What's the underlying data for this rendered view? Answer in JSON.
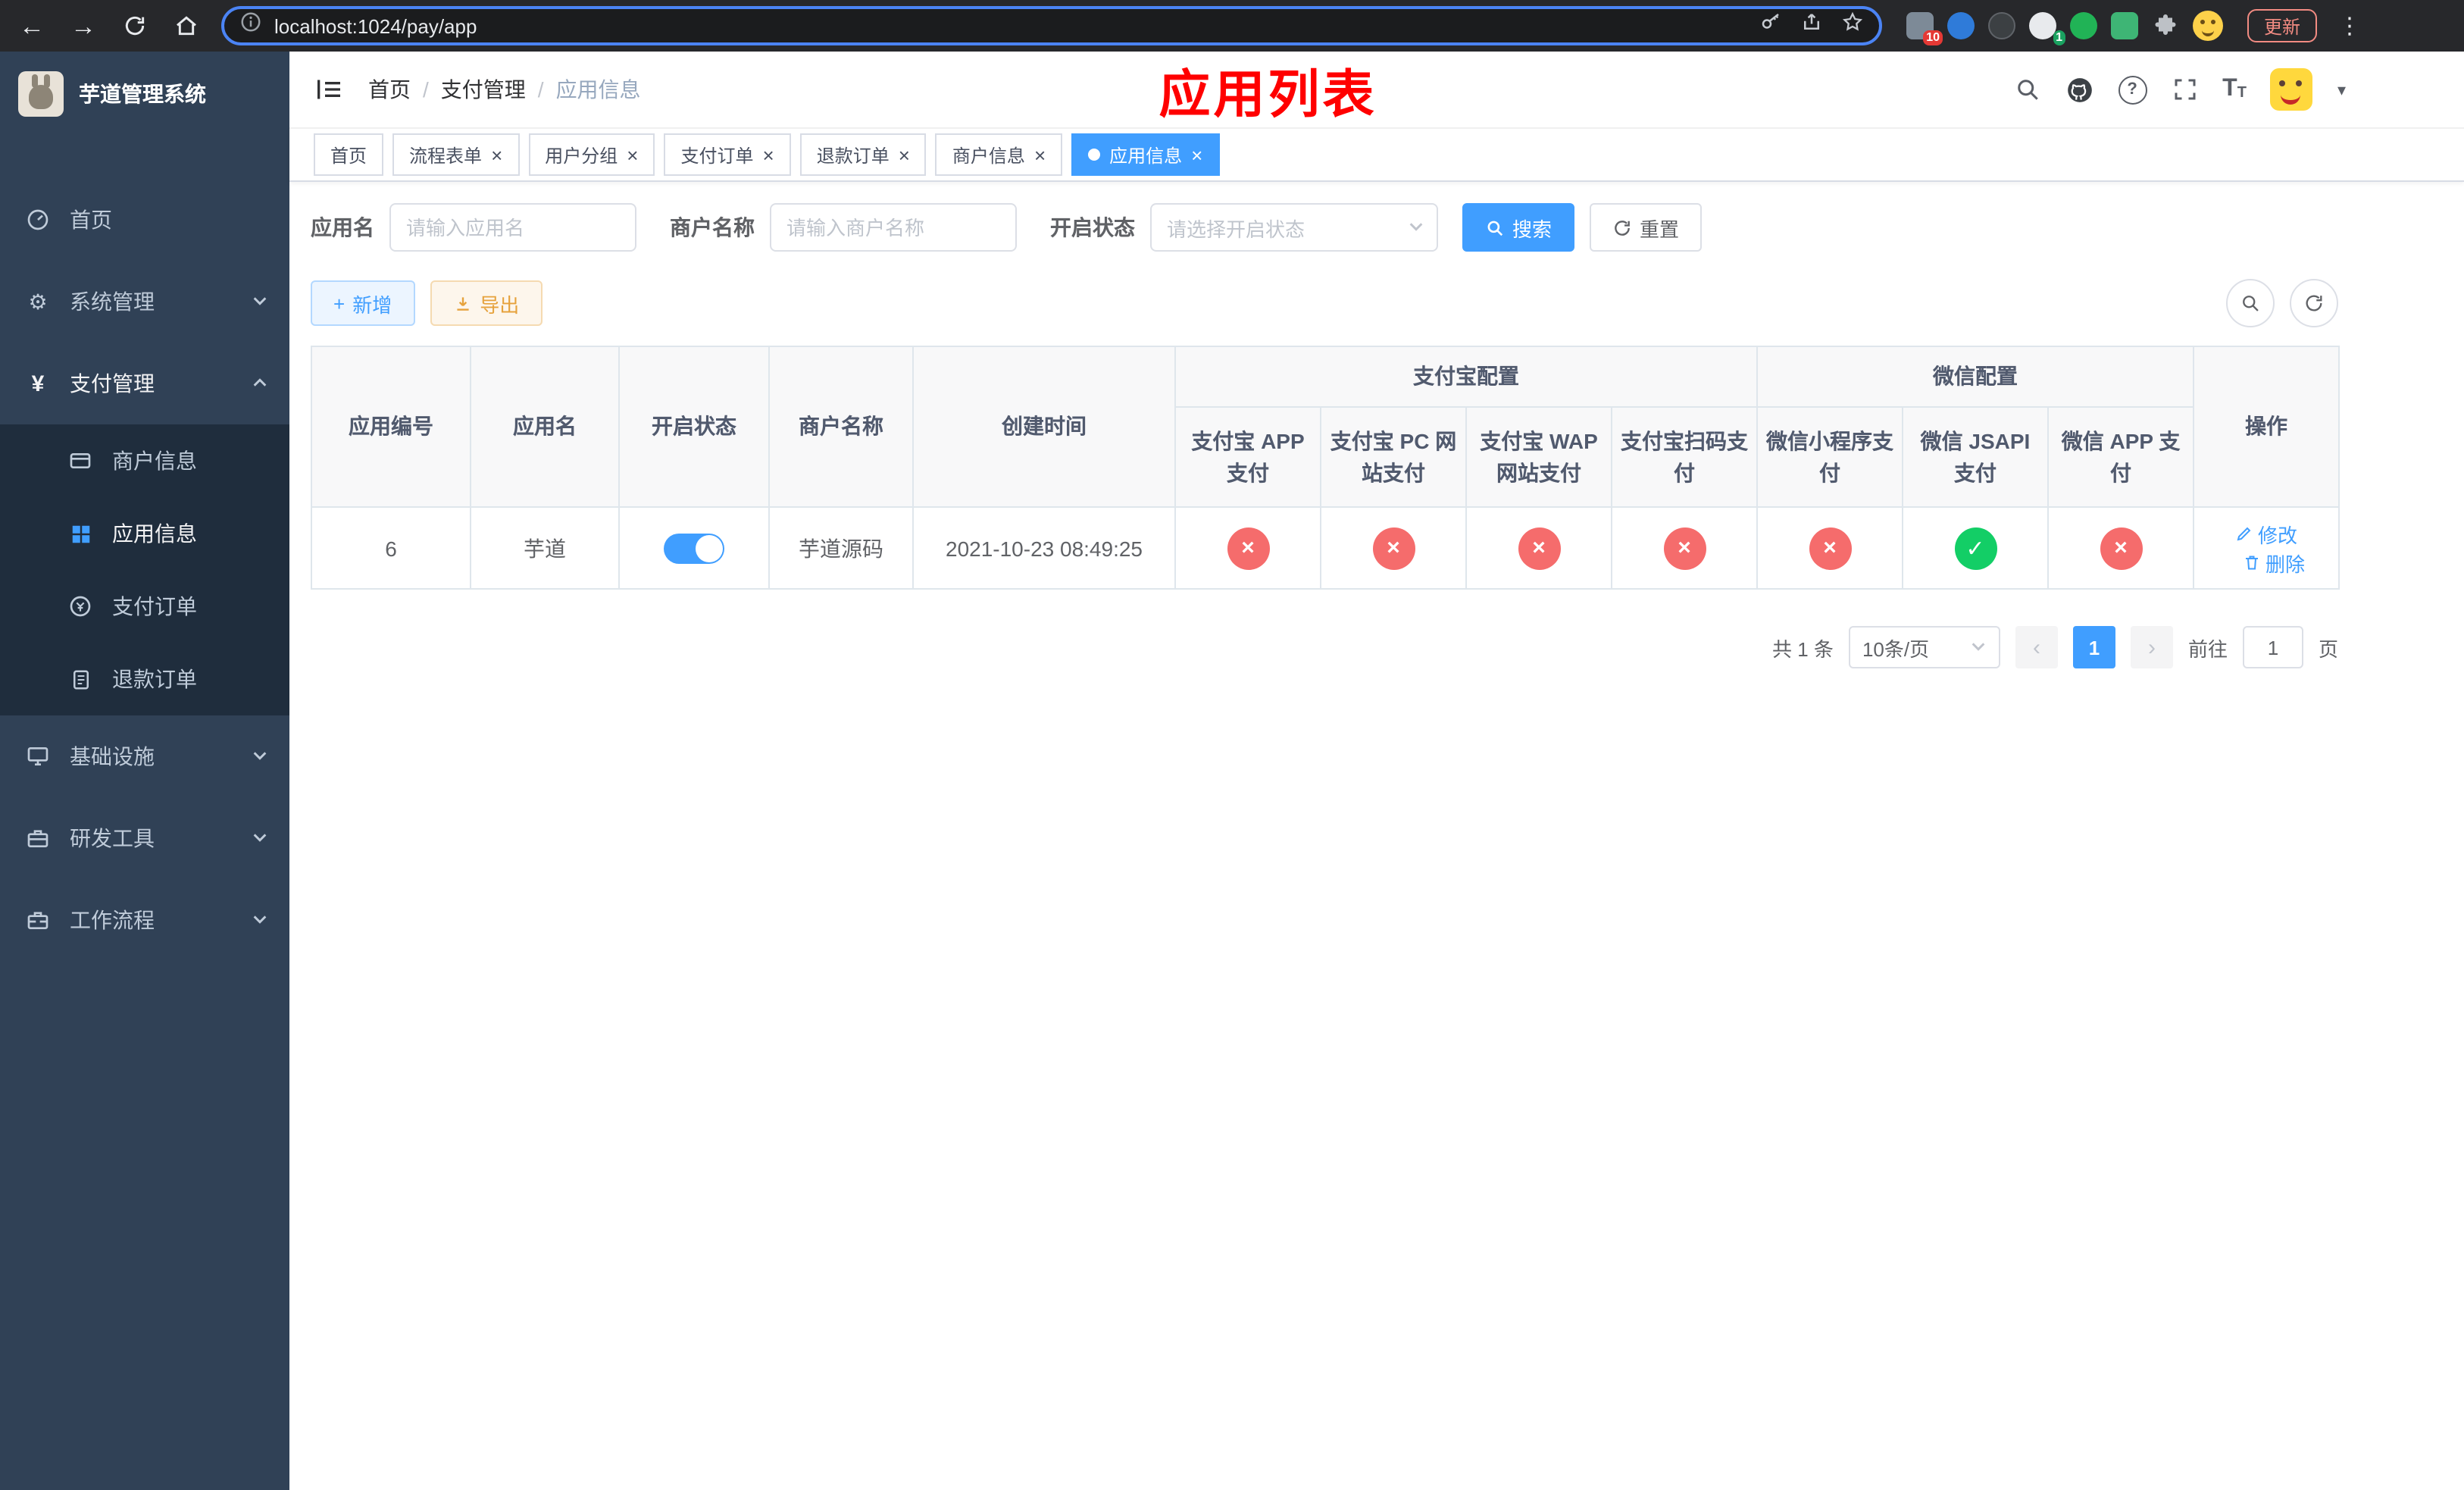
{
  "browser": {
    "url": "localhost:1024/pay/app",
    "update_label": "更新",
    "ext_badge_a": "10",
    "ext_badge_b": "1"
  },
  "icons": {
    "back": "←",
    "forward": "→",
    "kebab": "⋮",
    "close": "×",
    "prev": "‹",
    "next": "›",
    "caret_down": "▾",
    "gear": "⚙",
    "yen": "¥",
    "plus": "+",
    "question": "?",
    "text_large": "T",
    "text_small": "T",
    "breadcrumb_separator": "/"
  },
  "sidebar": {
    "app_title": "芋道管理系统",
    "items": [
      {
        "label": "首页"
      },
      {
        "label": "系统管理"
      },
      {
        "label": "支付管理"
      },
      {
        "label": "基础设施"
      },
      {
        "label": "研发工具"
      },
      {
        "label": "工作流程"
      }
    ],
    "payment_children": [
      {
        "label": "商户信息"
      },
      {
        "label": "应用信息"
      },
      {
        "label": "支付订单"
      },
      {
        "label": "退款订单"
      }
    ]
  },
  "navbar": {
    "breadcrumb": [
      "首页",
      "支付管理",
      "应用信息"
    ],
    "page_title": "应用列表"
  },
  "tabs": [
    {
      "label": "首页",
      "closable": false,
      "active": false
    },
    {
      "label": "流程表单",
      "closable": true,
      "active": false
    },
    {
      "label": "用户分组",
      "closable": true,
      "active": false
    },
    {
      "label": "支付订单",
      "closable": true,
      "active": false
    },
    {
      "label": "退款订单",
      "closable": true,
      "active": false
    },
    {
      "label": "商户信息",
      "closable": true,
      "active": false
    },
    {
      "label": "应用信息",
      "closable": true,
      "active": true
    }
  ],
  "filters": {
    "app_name": {
      "label": "应用名",
      "placeholder": "请输入应用名"
    },
    "merchant": {
      "label": "商户名称",
      "placeholder": "请输入商户名称"
    },
    "status": {
      "label": "开启状态",
      "placeholder": "请选择开启状态"
    },
    "search_label": "搜索",
    "reset_label": "重置"
  },
  "toolbar": {
    "add_label": "新增",
    "export_label": "导出"
  },
  "table": {
    "group_alipay": "支付宝配置",
    "group_wechat": "微信配置",
    "col_id": "应用编号",
    "col_name": "应用名",
    "col_status": "开启状态",
    "col_merchant": "商户名称",
    "col_created": "创建时间",
    "col_alipay_app": "支付宝 APP 支付",
    "col_alipay_pc": "支付宝 PC 网站支付",
    "col_alipay_wap": "支付宝 WAP 网站支付",
    "col_alipay_qr": "支付宝扫码支付",
    "col_wechat_mini": "微信小程序支付",
    "col_wechat_jsapi": "微信 JSAPI 支付",
    "col_wechat_app": "微信 APP 支付",
    "col_actions": "操作",
    "glyphs": {
      "no": "×",
      "yes": "✓"
    },
    "row": {
      "id": "6",
      "name": "芋道",
      "enabled": true,
      "merchant": "芋道源码",
      "created": "2021-10-23 08:49:25",
      "config": {
        "alipay_app": false,
        "alipay_pc": false,
        "alipay_wap": false,
        "alipay_qr": false,
        "wechat_mini": false,
        "wechat_jsapi": true,
        "wechat_app": false
      },
      "edit_label": "修改",
      "delete_label": "删除"
    }
  },
  "pagination": {
    "total": "共 1 条",
    "page_size": "10条/页",
    "page": "1",
    "goto_prefix": "前往",
    "goto_value": "1",
    "goto_suffix": "页"
  },
  "colors": {
    "primary": "#409eff",
    "success": "#13ce66",
    "danger": "#f56c6c",
    "title_red": "#ff0000",
    "sidebar_bg": "#304156",
    "sidebar_submenu_bg": "#1f2d3d"
  }
}
